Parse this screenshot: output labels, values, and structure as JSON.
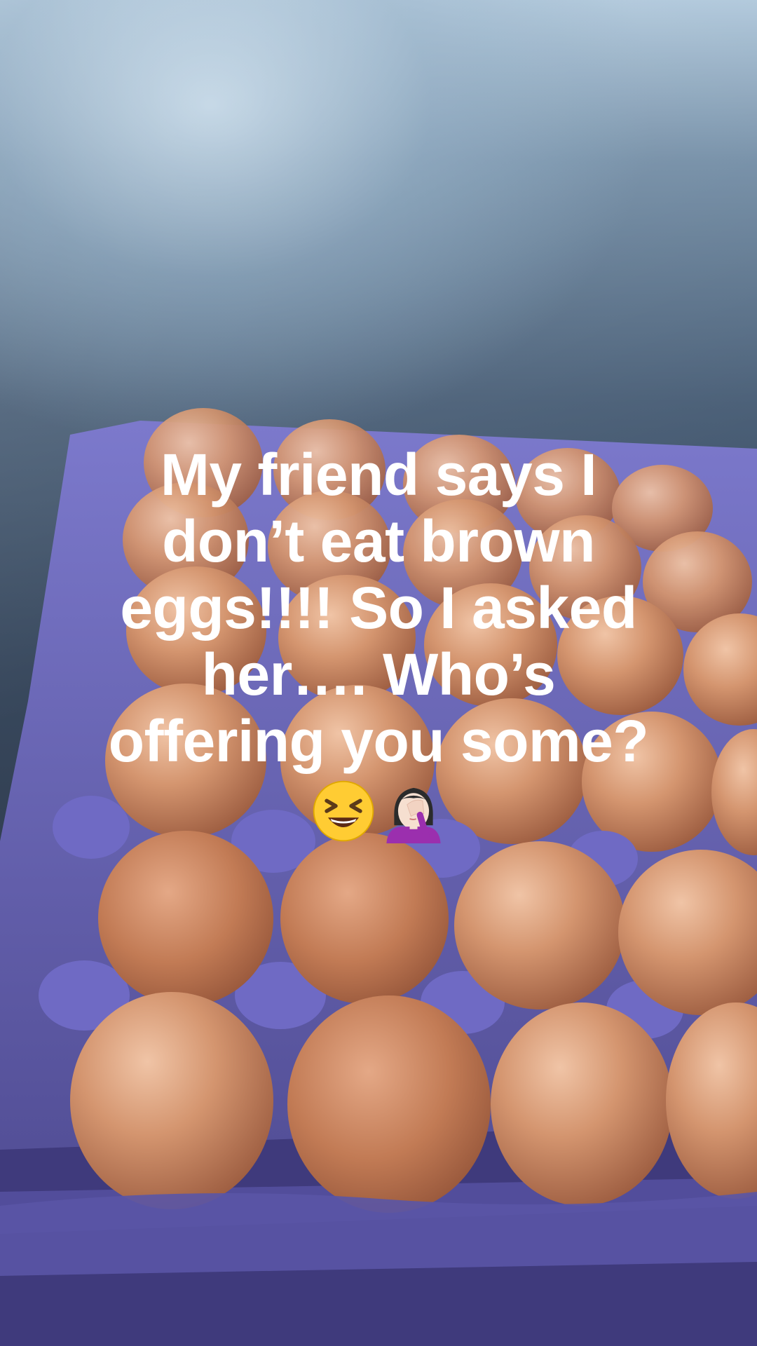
{
  "caption": {
    "lines": [
      "My friend says I",
      "don’t eat brown",
      "eggs!!!! So I asked",
      "her…. Who’s",
      "offering you some?"
    ]
  },
  "emojis": [
    "grinning-squinting-face",
    "woman-facepalming"
  ],
  "colors": {
    "carton": "#5e56a8",
    "egg": "#c98a66",
    "text": "#ffffff"
  }
}
